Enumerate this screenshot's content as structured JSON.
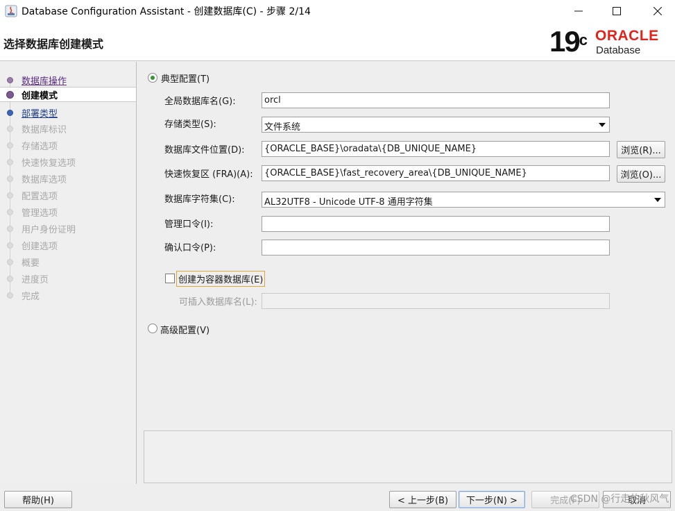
{
  "window": {
    "title": "Database Configuration Assistant - 创建数据库(C) - 步骤 2/14",
    "controls": {
      "minimize": "—",
      "maximize": "☐",
      "close": "✕"
    }
  },
  "header": {
    "page_title": "选择数据库创建模式",
    "logo_version": "19",
    "logo_version_suffix": "c",
    "logo_brand": "ORACLE",
    "logo_product": "Database"
  },
  "sidebar": {
    "steps": [
      {
        "label": "数据库操作",
        "state": "done"
      },
      {
        "label": "创建模式",
        "state": "current"
      },
      {
        "label": "部署类型",
        "state": "link"
      },
      {
        "label": "数据库标识",
        "state": "disabled"
      },
      {
        "label": "存储选项",
        "state": "disabled"
      },
      {
        "label": "快速恢复选项",
        "state": "disabled"
      },
      {
        "label": "数据库选项",
        "state": "disabled"
      },
      {
        "label": "配置选项",
        "state": "disabled"
      },
      {
        "label": "管理选项",
        "state": "disabled"
      },
      {
        "label": "用户身份证明",
        "state": "disabled"
      },
      {
        "label": "创建选项",
        "state": "disabled"
      },
      {
        "label": "概要",
        "state": "disabled"
      },
      {
        "label": "进度页",
        "state": "disabled"
      },
      {
        "label": "完成",
        "state": "disabled"
      }
    ]
  },
  "form": {
    "typical_label": "典型配置(T)",
    "typical_selected": true,
    "global_db_name_label": "全局数据库名(G):",
    "global_db_name_value": "orcl",
    "storage_type_label": "存储类型(S):",
    "storage_type_value": "文件系统",
    "db_file_location_label": "数据库文件位置(D):",
    "db_file_location_value": "{ORACLE_BASE}\\oradata\\{DB_UNIQUE_NAME}",
    "browse_r_label": "浏览(R)...",
    "fra_label": "快速恢复区 (FRA)(A):",
    "fra_value": "{ORACLE_BASE}\\fast_recovery_area\\{DB_UNIQUE_NAME}",
    "browse_o_label": "浏览(O)...",
    "charset_label": "数据库字符集(C):",
    "charset_value": "AL32UTF8 - Unicode UTF-8 通用字符集",
    "admin_password_label": "管理口令(I):",
    "admin_password_value": "",
    "confirm_password_label": "确认口令(P):",
    "confirm_password_value": "",
    "container_db_label": "创建为容器数据库(E)",
    "container_db_checked": false,
    "pdb_name_label": "可插入数据库名(L):",
    "pdb_name_value": "",
    "advanced_label": "高级配置(V)",
    "advanced_selected": false
  },
  "footer": {
    "help": "帮助(H)",
    "back": "< 上一步(B)",
    "next": "下一步(N) >",
    "finish": "完成(F)",
    "cancel": "取消",
    "watermark": "CSDN @行走的秋风气"
  }
}
